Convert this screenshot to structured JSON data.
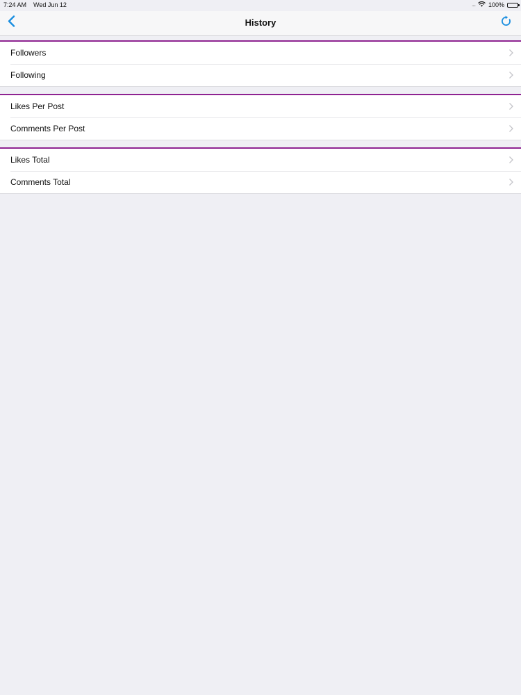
{
  "status_bar": {
    "time": "7:24 AM",
    "date": "Wed Jun 12",
    "battery": "100%"
  },
  "nav": {
    "title": "History",
    "back_icon": "chevron-left-icon",
    "refresh_icon": "refresh-icon"
  },
  "colors": {
    "accent": "#1a8ee0",
    "section_rule": "#8e2391",
    "background": "#efeff4"
  },
  "sections": [
    {
      "rows": [
        {
          "label": "Followers"
        },
        {
          "label": "Following"
        }
      ]
    },
    {
      "rows": [
        {
          "label": "Likes Per Post"
        },
        {
          "label": "Comments Per Post"
        }
      ]
    },
    {
      "rows": [
        {
          "label": "Likes Total"
        },
        {
          "label": "Comments Total"
        }
      ]
    }
  ]
}
